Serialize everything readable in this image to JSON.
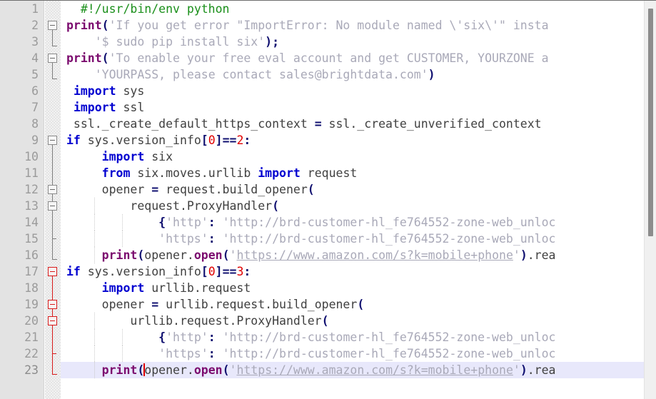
{
  "editor": {
    "language": "python",
    "filename_hint": "python",
    "theme_colors": {
      "background": "#ffffff",
      "gutter_background": "#e3e3e3",
      "line_number": "#9b9b9b",
      "current_line_highlight": "#e8e8fb",
      "keyword": "#0000d0",
      "function": "#7b0a6e",
      "operator": "#101070",
      "number": "#e00000",
      "string": "#a9a9b8",
      "comment": "#1a8f1a",
      "plain_text": "#404040",
      "fold_marker_active": "#d81a1a",
      "fold_marker_inactive": "#7d7d7d",
      "scrollbar_thumb": "#8c8c8c"
    },
    "current_line": 23,
    "total_visible_lines": 23,
    "scrollbar": {
      "orientation": "vertical",
      "thumb_top_pct": 2,
      "thumb_height_pct": 57
    }
  },
  "line_numbers": [
    "1",
    "2",
    "3",
    "4",
    "5",
    "6",
    "7",
    "8",
    "9",
    "10",
    "11",
    "12",
    "13",
    "14",
    "15",
    "16",
    "17",
    "18",
    "19",
    "20",
    "21",
    "22",
    "23"
  ],
  "code_lines": [
    {
      "n": "1",
      "tokens": [
        {
          "t": "plain",
          "s": "  "
        },
        {
          "t": "cmt",
          "s": "#!/usr/bin/env python"
        }
      ]
    },
    {
      "n": "2",
      "tokens": [
        {
          "t": "fn",
          "s": "print"
        },
        {
          "t": "brace",
          "s": "("
        },
        {
          "t": "str",
          "s": "'If you get error \"ImportError: No module named \\'six\\'\" insta"
        }
      ]
    },
    {
      "n": "3",
      "tokens": [
        {
          "t": "plain",
          "s": "    "
        },
        {
          "t": "str",
          "s": "'$ sudo pip install six'"
        },
        {
          "t": "brace",
          "s": ")"
        },
        {
          "t": "op",
          "s": ";"
        }
      ]
    },
    {
      "n": "4",
      "tokens": [
        {
          "t": "fn",
          "s": "print"
        },
        {
          "t": "brace",
          "s": "("
        },
        {
          "t": "str",
          "s": "'To enable your free eval account and get CUSTOMER, YOURZONE a"
        }
      ]
    },
    {
      "n": "5",
      "tokens": [
        {
          "t": "plain",
          "s": "    "
        },
        {
          "t": "str",
          "s": "'YOURPASS, please contact sales@brightdata.com'"
        },
        {
          "t": "brace",
          "s": ")"
        }
      ]
    },
    {
      "n": "6",
      "tokens": [
        {
          "t": "plain",
          "s": " "
        },
        {
          "t": "kw",
          "s": "import"
        },
        {
          "t": "plain",
          "s": " sys"
        }
      ]
    },
    {
      "n": "7",
      "tokens": [
        {
          "t": "plain",
          "s": " "
        },
        {
          "t": "kw",
          "s": "import"
        },
        {
          "t": "plain",
          "s": " ssl"
        }
      ]
    },
    {
      "n": "8",
      "tokens": [
        {
          "t": "plain",
          "s": " ssl._create_default_https_context "
        },
        {
          "t": "op",
          "s": "="
        },
        {
          "t": "plain",
          "s": " ssl._create_unverified_context"
        }
      ]
    },
    {
      "n": "9",
      "tokens": [
        {
          "t": "kw",
          "s": "if"
        },
        {
          "t": "plain",
          "s": " sys.version_info"
        },
        {
          "t": "brace",
          "s": "["
        },
        {
          "t": "num",
          "s": "0"
        },
        {
          "t": "brace",
          "s": "]"
        },
        {
          "t": "op",
          "s": "=="
        },
        {
          "t": "num",
          "s": "2"
        },
        {
          "t": "op",
          "s": ":"
        }
      ]
    },
    {
      "n": "10",
      "tokens": [
        {
          "t": "plain",
          "s": "     "
        },
        {
          "t": "kw",
          "s": "import"
        },
        {
          "t": "plain",
          "s": " six"
        }
      ]
    },
    {
      "n": "11",
      "tokens": [
        {
          "t": "plain",
          "s": "     "
        },
        {
          "t": "kw",
          "s": "from"
        },
        {
          "t": "plain",
          "s": " six.moves.urllib "
        },
        {
          "t": "kw",
          "s": "import"
        },
        {
          "t": "plain",
          "s": " request"
        }
      ]
    },
    {
      "n": "12",
      "tokens": [
        {
          "t": "plain",
          "s": "     opener "
        },
        {
          "t": "op",
          "s": "="
        },
        {
          "t": "plain",
          "s": " request.build_opener"
        },
        {
          "t": "brace",
          "s": "("
        }
      ]
    },
    {
      "n": "13",
      "tokens": [
        {
          "t": "plain",
          "s": "         request.ProxyHandler"
        },
        {
          "t": "brace",
          "s": "("
        }
      ]
    },
    {
      "n": "14",
      "tokens": [
        {
          "t": "plain",
          "s": "             "
        },
        {
          "t": "brace",
          "s": "{"
        },
        {
          "t": "str",
          "s": "'http'"
        },
        {
          "t": "op",
          "s": ":"
        },
        {
          "t": "plain",
          "s": " "
        },
        {
          "t": "str",
          "s": "'http://brd-customer-hl_fe764552-zone-web_unloc"
        }
      ]
    },
    {
      "n": "15",
      "tokens": [
        {
          "t": "plain",
          "s": "             "
        },
        {
          "t": "str",
          "s": "'https'"
        },
        {
          "t": "op",
          "s": ":"
        },
        {
          "t": "plain",
          "s": " "
        },
        {
          "t": "str",
          "s": "'http://brd-customer-hl_fe764552-zone-web_unloc"
        }
      ]
    },
    {
      "n": "16",
      "tokens": [
        {
          "t": "plain",
          "s": "     "
        },
        {
          "t": "fn",
          "s": "print"
        },
        {
          "t": "brace",
          "s": "("
        },
        {
          "t": "plain",
          "s": "opener."
        },
        {
          "t": "fn",
          "s": "open"
        },
        {
          "t": "brace",
          "s": "("
        },
        {
          "t": "str",
          "s": "'"
        },
        {
          "t": "url",
          "s": "https://www.amazon.com/s?k=mobile+phone"
        },
        {
          "t": "str",
          "s": "'"
        },
        {
          "t": "brace",
          "s": ")"
        },
        {
          "t": "plain",
          "s": ".rea"
        }
      ]
    },
    {
      "n": "17",
      "tokens": [
        {
          "t": "kw",
          "s": "if"
        },
        {
          "t": "plain",
          "s": " sys.version_info"
        },
        {
          "t": "brace",
          "s": "["
        },
        {
          "t": "num",
          "s": "0"
        },
        {
          "t": "brace",
          "s": "]"
        },
        {
          "t": "op",
          "s": "=="
        },
        {
          "t": "num",
          "s": "3"
        },
        {
          "t": "op",
          "s": ":"
        }
      ]
    },
    {
      "n": "18",
      "tokens": [
        {
          "t": "plain",
          "s": "     "
        },
        {
          "t": "kw",
          "s": "import"
        },
        {
          "t": "plain",
          "s": " urllib.request"
        }
      ]
    },
    {
      "n": "19",
      "tokens": [
        {
          "t": "plain",
          "s": "     opener "
        },
        {
          "t": "op",
          "s": "="
        },
        {
          "t": "plain",
          "s": " urllib.request.build_opener"
        },
        {
          "t": "brace",
          "s": "("
        }
      ]
    },
    {
      "n": "20",
      "tokens": [
        {
          "t": "plain",
          "s": "         urllib.request.ProxyHandler"
        },
        {
          "t": "brace",
          "s": "("
        }
      ]
    },
    {
      "n": "21",
      "tokens": [
        {
          "t": "plain",
          "s": "             "
        },
        {
          "t": "brace",
          "s": "{"
        },
        {
          "t": "str",
          "s": "'http'"
        },
        {
          "t": "op",
          "s": ":"
        },
        {
          "t": "plain",
          "s": " "
        },
        {
          "t": "str",
          "s": "'http://brd-customer-hl_fe764552-zone-web_unloc"
        }
      ]
    },
    {
      "n": "22",
      "tokens": [
        {
          "t": "plain",
          "s": "             "
        },
        {
          "t": "str",
          "s": "'https'"
        },
        {
          "t": "op",
          "s": ":"
        },
        {
          "t": "plain",
          "s": " "
        },
        {
          "t": "str",
          "s": "'http://brd-customer-hl_fe764552-zone-web_unloc"
        }
      ]
    },
    {
      "n": "23",
      "current": true,
      "tokens": [
        {
          "t": "plain",
          "s": "     "
        },
        {
          "t": "fn",
          "s": "print"
        },
        {
          "t": "brace",
          "s": "("
        },
        {
          "t": "caret",
          "s": ""
        },
        {
          "t": "plain",
          "s": "opener."
        },
        {
          "t": "fn",
          "s": "open"
        },
        {
          "t": "brace",
          "s": "("
        },
        {
          "t": "str",
          "s": "'"
        },
        {
          "t": "url",
          "s": "https://www.amazon.com/s?k=mobile+phone"
        },
        {
          "t": "str",
          "s": "'"
        },
        {
          "t": "brace",
          "s": ")"
        },
        {
          "t": "plain",
          "s": ".rea"
        }
      ]
    }
  ],
  "fold_markers": [
    {
      "line": 2,
      "type": "box",
      "state": "expanded",
      "active": false
    },
    {
      "line": 3,
      "type": "end",
      "active": false
    },
    {
      "line": 4,
      "type": "box",
      "state": "expanded",
      "active": false
    },
    {
      "line": 5,
      "type": "end",
      "active": false
    },
    {
      "line": 9,
      "type": "box",
      "state": "expanded",
      "active": false
    },
    {
      "line": 12,
      "type": "box",
      "state": "expanded",
      "active": false
    },
    {
      "line": 13,
      "type": "box",
      "state": "expanded",
      "active": false
    },
    {
      "line": 15,
      "type": "tick",
      "active": false
    },
    {
      "line": 16,
      "type": "end",
      "active": false
    },
    {
      "line": 17,
      "type": "box",
      "state": "expanded",
      "active": true
    },
    {
      "line": 19,
      "type": "box",
      "state": "expanded",
      "active": true
    },
    {
      "line": 20,
      "type": "box",
      "state": "expanded",
      "active": true
    },
    {
      "line": 22,
      "type": "tick",
      "active": true
    },
    {
      "line": 23,
      "type": "end",
      "active": true
    }
  ],
  "indent_guides": [
    {
      "from_line": 13,
      "to_line": 16,
      "level": 1
    },
    {
      "from_line": 14,
      "to_line": 15,
      "level": 2
    },
    {
      "from_line": 20,
      "to_line": 23,
      "level": 1
    },
    {
      "from_line": 21,
      "to_line": 22,
      "level": 2
    }
  ]
}
